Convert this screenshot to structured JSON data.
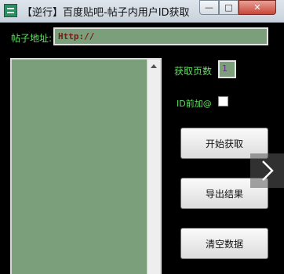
{
  "window": {
    "title": "【逆行】百度贴吧-帖子内用户ID获取",
    "minimize_glyph": "—",
    "maximize_glyph": "□",
    "close_glyph": "✕"
  },
  "form": {
    "url_label": "帖子地址:",
    "url_value": "Http://",
    "pages_label": "获取页数",
    "pages_value": "1",
    "at_prefix_label": "ID前加@",
    "at_prefix_checked": false
  },
  "results": {
    "items": []
  },
  "buttons": {
    "start": "开始获取",
    "export": "导出结果",
    "clear": "清空数据"
  },
  "icons": {
    "app": "app-icon",
    "next": "chevron-right-icon",
    "scroll_up": "scroll-up-arrow-icon"
  },
  "colors": {
    "background": "#000000",
    "label_green": "#5ee05e",
    "field_green": "#7b9e7b"
  }
}
